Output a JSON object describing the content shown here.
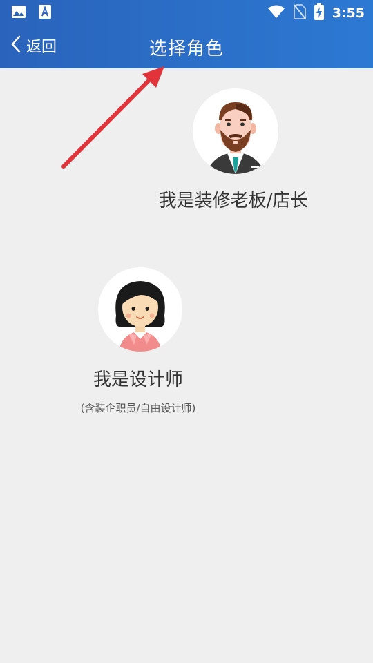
{
  "status_bar": {
    "time": "3:55",
    "icons": [
      "image-icon",
      "text-a-icon",
      "wifi-icon",
      "no-sim-icon",
      "battery-charging-icon"
    ]
  },
  "header": {
    "back_label": "返回",
    "title": "选择角色",
    "colors": {
      "bar_start": "#2a63bb",
      "bar_end": "#2c79d3"
    }
  },
  "roles": [
    {
      "label": "我是装修老板/店长",
      "icon": "businessman-avatar-icon"
    },
    {
      "label": "我是设计师",
      "subtitle": "(含装企职员/自由设计师)",
      "icon": "woman-designer-avatar-icon"
    }
  ],
  "annotation": {
    "icon": "red-arrow-icon",
    "color": "#e2323a"
  }
}
